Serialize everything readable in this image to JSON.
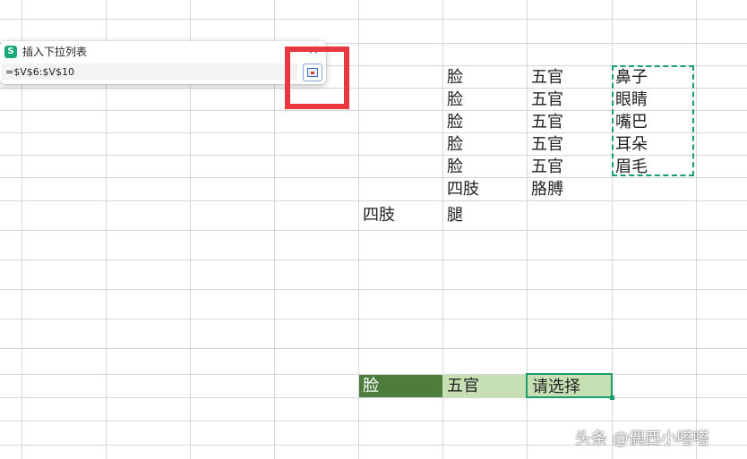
{
  "dialog": {
    "title": "插入下拉列表",
    "reference_value": "=$V$6:$V$10",
    "app_icon_letter": "S",
    "close_symbol": "×"
  },
  "cells": {
    "d1": {
      "c1": "脸",
      "c2": "五官",
      "c3": "鼻子"
    },
    "d2": {
      "c1": "脸",
      "c2": "五官",
      "c3": "眼睛"
    },
    "d3": {
      "c1": "脸",
      "c2": "五官",
      "c3": "嘴巴"
    },
    "d4": {
      "c1": "脸",
      "c2": "五官",
      "c3": "耳朵"
    },
    "d5": {
      "c1": "脸",
      "c2": "五官",
      "c3": "眉毛"
    },
    "d6": {
      "c1": "四肢",
      "c2": "胳膊"
    },
    "d7": {
      "c0": "四肢",
      "c1": "腿"
    },
    "sel": {
      "c0": "脸",
      "c1": "五官",
      "c2": "请选择"
    }
  },
  "watermark": "头条 @偶西小嗒嗒",
  "colors": {
    "gridline": "#d4d6dc",
    "dark_green_fill": "#4e7c3d",
    "light_green_fill": "#c6e0b4",
    "selection_border": "#1a9e6e",
    "copy_marquee": "#1a9e6e",
    "highlight_box": "#e8373e",
    "app_icon": "#1aa77a"
  }
}
